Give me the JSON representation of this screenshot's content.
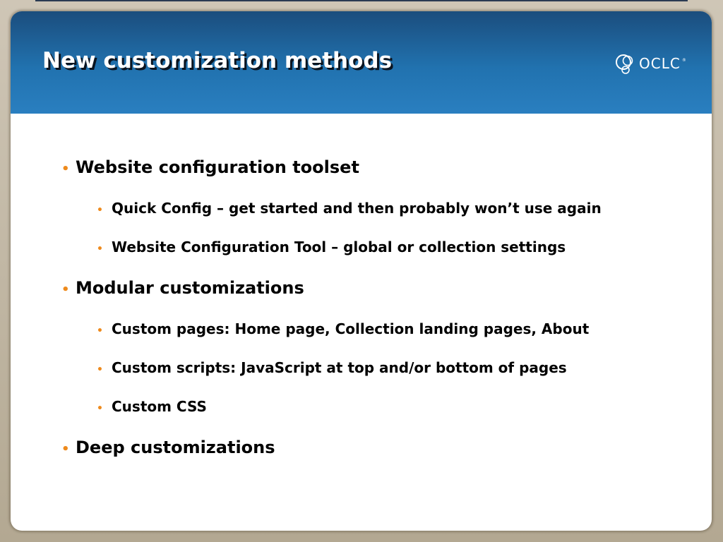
{
  "slide": {
    "title": "New customization methods",
    "logo": {
      "text": "OCLC",
      "trademark": "®",
      "icon": "oclc-globe-icon"
    },
    "bullet_symbol": "•",
    "accent_color": "#ee8a1c",
    "header_color": "#2172af",
    "items": [
      {
        "level": 1,
        "text": "Website configuration toolset"
      },
      {
        "level": 2,
        "text": "Quick Config – get started and then probably won’t use again"
      },
      {
        "level": 2,
        "text": "Website Configuration Tool – global or collection settings"
      },
      {
        "level": 1,
        "text": "Modular customizations"
      },
      {
        "level": 2,
        "text": "Custom pages: Home page, Collection landing pages, About"
      },
      {
        "level": 2,
        "text": "Custom scripts: JavaScript at top and/or bottom of pages"
      },
      {
        "level": 2,
        "text": "Custom CSS"
      },
      {
        "level": 1,
        "text": "Deep customizations"
      }
    ]
  }
}
